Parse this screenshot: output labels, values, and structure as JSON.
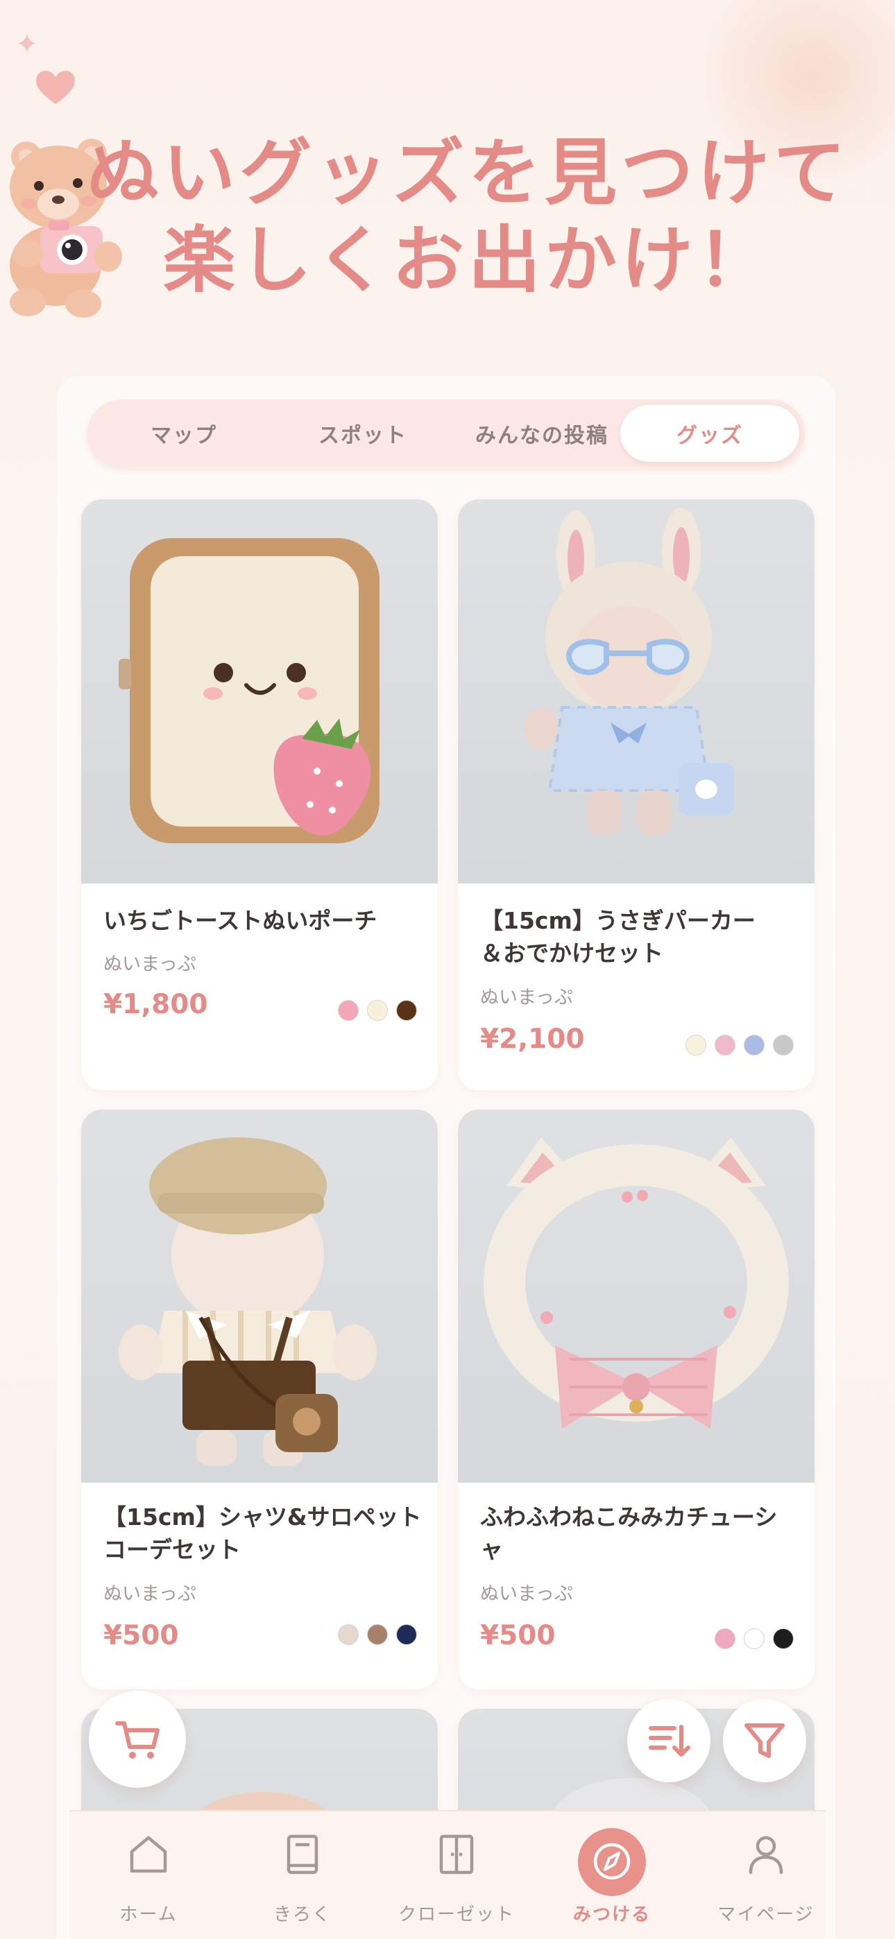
{
  "hero": {
    "line1": "ぬいグッズを見つけて",
    "line2": "楽しくお出かけ！"
  },
  "tabs": [
    {
      "label": "マップ",
      "active": false
    },
    {
      "label": "スポット",
      "active": false
    },
    {
      "label": "みんなの投稿",
      "active": false
    },
    {
      "label": "グッズ",
      "active": true
    }
  ],
  "products": [
    {
      "title": "いちごトーストぬいポーチ",
      "shop": "ぬいまっぷ",
      "price": "¥1,800",
      "colors": [
        "#f2a6b6",
        "#f7f1dc",
        "#5a3216"
      ]
    },
    {
      "title": "【15cm】うさぎパーカー\n＆おでかけセット",
      "shop": "ぬいまっぷ",
      "price": "¥2,100",
      "colors": [
        "#f8f1dc",
        "#edbacb",
        "#a9bde4",
        "#c8c8c8"
      ]
    },
    {
      "title": "【15cm】シャツ&サロペット\nコーデセット",
      "shop": "ぬいまっぷ",
      "price": "¥500",
      "colors": [
        "#e4d8cf",
        "#a7826a",
        "#1e2b57"
      ]
    },
    {
      "title": "ふわふわねこみみカチューシャ",
      "shop": "ぬいまっぷ",
      "price": "¥500",
      "colors": [
        "#f0a8c0",
        "#ffffff",
        "#1d1d1d"
      ]
    }
  ],
  "fabs": {
    "cart": "cart-icon",
    "sort": "sort-icon",
    "filter": "filter-icon"
  },
  "tabbar": [
    {
      "label": "ホーム",
      "icon": "home-icon",
      "active": false
    },
    {
      "label": "きろく",
      "icon": "book-icon",
      "active": false
    },
    {
      "label": "クローゼット",
      "icon": "closet-icon",
      "active": false
    },
    {
      "label": "みつける",
      "icon": "compass-icon",
      "active": true
    },
    {
      "label": "マイページ",
      "icon": "person-icon",
      "active": false
    }
  ],
  "colors": {
    "accent": "#e48b87",
    "tab_bg": "#fbe7e3",
    "background": "#fcf1ec"
  }
}
